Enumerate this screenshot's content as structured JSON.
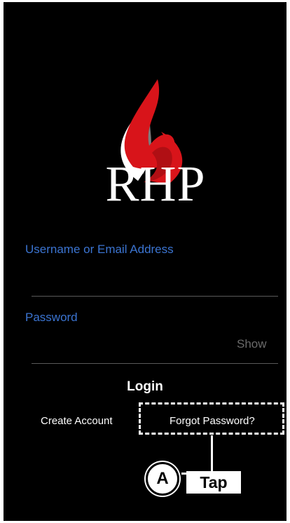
{
  "logo": {
    "text": "RHP",
    "flame_colors": [
      "#d8141a",
      "#ffffff",
      "#8a8a8a"
    ]
  },
  "form": {
    "username_label": "Username or Email Address",
    "password_label": "Password",
    "show_toggle": "Show",
    "login_button": "Login"
  },
  "links": {
    "create_account": "Create Account",
    "forgot_password": "Forgot Password?"
  },
  "annotation": {
    "badge": "A",
    "instruction": "Tap"
  },
  "colors": {
    "accent": "#3b74d1",
    "background": "#000000"
  }
}
